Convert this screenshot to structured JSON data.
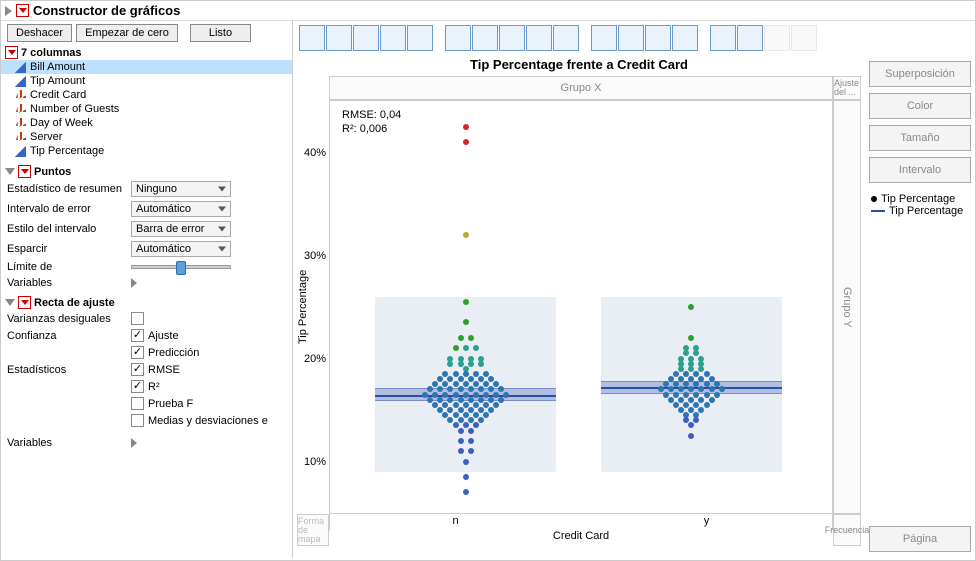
{
  "header": {
    "title": "Constructor de gráficos"
  },
  "buttons": {
    "undo": "Deshacer",
    "fresh": "Empezar de cero",
    "done": "Listo"
  },
  "columns_header": "7 columnas",
  "columns": [
    {
      "name": "Bill Amount",
      "type": "cont",
      "selected": true
    },
    {
      "name": "Tip Amount",
      "type": "cont"
    },
    {
      "name": "Credit Card",
      "type": "nom"
    },
    {
      "name": "Number of Guests",
      "type": "nom"
    },
    {
      "name": "Day of Week",
      "type": "nom"
    },
    {
      "name": "Server",
      "type": "nom"
    },
    {
      "name": "Tip Percentage",
      "type": "cont"
    }
  ],
  "section_points": "Puntos",
  "points": {
    "summary_label": "Estadístico de resumen",
    "summary_val": "Ninguno",
    "error_label": "Intervalo de error",
    "error_val": "Automático",
    "style_label": "Estilo del intervalo",
    "style_val": "Barra de error",
    "jitter_label": "Esparcir",
    "jitter_val": "Automático",
    "limit_label": "Límite de",
    "vars_label": "Variables"
  },
  "section_fit": "Recta de ajuste",
  "fit": {
    "uneq_label": "Varianzas desiguales",
    "conf_label": "Confianza",
    "ajuste": "Ajuste",
    "pred": "Predicción",
    "stats_label": "Estadísticos",
    "rmse": "RMSE",
    "r2": "R²",
    "ftest": "Prueba F",
    "means": "Medias y desviaciones e",
    "vars_label": "Variables"
  },
  "chart_title": "Tip Percentage frente a Credit Card",
  "dropzones": {
    "gx": "Grupo X",
    "ajuste": "Ajuste del ...",
    "gy": "Grupo Y",
    "forma": "Forma de mapa",
    "frec": "Frecuencia"
  },
  "side": {
    "superpos": "Superposición",
    "color": "Color",
    "tam": "Tamaño",
    "interval": "Intervalo",
    "pagina": "Página"
  },
  "legend": {
    "l1": "Tip Percentage",
    "l2": "Tip Percentage"
  },
  "chart_data": {
    "type": "scatter",
    "title": "Tip Percentage frente a Credit Card",
    "xlabel": "Credit Card",
    "ylabel": "Tip Percentage",
    "categories": [
      "n",
      "y"
    ],
    "ylim": [
      5,
      45
    ],
    "yticks": [
      10,
      20,
      30,
      40
    ],
    "ytick_labels": [
      "10%",
      "20%",
      "30%",
      "40%"
    ],
    "stats": {
      "rmse_label": "RMSE: 0,04",
      "r2_label": "R²: 0,006"
    },
    "fit": {
      "n": 16.5,
      "y": 17.2
    },
    "series": [
      {
        "name": "n",
        "points": [
          {
            "y": 42.5,
            "color": "#d62728"
          },
          {
            "y": 41.0,
            "color": "#d62728"
          },
          {
            "y": 32.0,
            "color": "#bfa82a"
          },
          {
            "y": 25.5,
            "color": "#2ca02c"
          },
          {
            "y": 23.5,
            "color": "#2ca02c"
          },
          {
            "y": 22.0,
            "color": "#2ca02c"
          },
          {
            "y": 22.0,
            "color": "#2ca02c"
          },
          {
            "y": 21.0,
            "color": "#2ca02c"
          },
          {
            "y": 21.0,
            "color": "#2d9f8f"
          },
          {
            "y": 21.0,
            "color": "#2d9f8f"
          },
          {
            "y": 20.0,
            "color": "#2d9f8f"
          },
          {
            "y": 20.0,
            "color": "#2d9f8f"
          },
          {
            "y": 20.0,
            "color": "#2d9f8f"
          },
          {
            "y": 20.0,
            "color": "#2d9f8f"
          },
          {
            "y": 19.5,
            "color": "#2d9f8f"
          },
          {
            "y": 19.5,
            "color": "#2d9f8f"
          },
          {
            "y": 19.5,
            "color": "#2d9f8f"
          },
          {
            "y": 19.5,
            "color": "#2d9f8f"
          },
          {
            "y": 19.0,
            "color": "#2d9f8f"
          },
          {
            "y": 18.5,
            "color": "#2d74b0"
          },
          {
            "y": 18.5,
            "color": "#2d74b0"
          },
          {
            "y": 18.5,
            "color": "#2d74b0"
          },
          {
            "y": 18.5,
            "color": "#2d74b0"
          },
          {
            "y": 18.5,
            "color": "#2d74b0"
          },
          {
            "y": 18.0,
            "color": "#2d74b0"
          },
          {
            "y": 18.0,
            "color": "#2d74b0"
          },
          {
            "y": 18.0,
            "color": "#2d74b0"
          },
          {
            "y": 18.0,
            "color": "#2d74b0"
          },
          {
            "y": 18.0,
            "color": "#2d74b0"
          },
          {
            "y": 18.0,
            "color": "#2d74b0"
          },
          {
            "y": 17.5,
            "color": "#2d74b0"
          },
          {
            "y": 17.5,
            "color": "#2d74b0"
          },
          {
            "y": 17.5,
            "color": "#2d74b0"
          },
          {
            "y": 17.5,
            "color": "#2d74b0"
          },
          {
            "y": 17.5,
            "color": "#2d74b0"
          },
          {
            "y": 17.5,
            "color": "#2d74b0"
          },
          {
            "y": 17.5,
            "color": "#2d74b0"
          },
          {
            "y": 17.0,
            "color": "#2d74b0"
          },
          {
            "y": 17.0,
            "color": "#2d74b0"
          },
          {
            "y": 17.0,
            "color": "#2d74b0"
          },
          {
            "y": 17.0,
            "color": "#2d74b0"
          },
          {
            "y": 17.0,
            "color": "#2d74b0"
          },
          {
            "y": 17.0,
            "color": "#2d74b0"
          },
          {
            "y": 17.0,
            "color": "#2d74b0"
          },
          {
            "y": 17.0,
            "color": "#2d74b0"
          },
          {
            "y": 16.5,
            "color": "#2d74b0"
          },
          {
            "y": 16.5,
            "color": "#2d74b0"
          },
          {
            "y": 16.5,
            "color": "#2d74b0"
          },
          {
            "y": 16.5,
            "color": "#2d74b0"
          },
          {
            "y": 16.5,
            "color": "#2d74b0"
          },
          {
            "y": 16.5,
            "color": "#2d74b0"
          },
          {
            "y": 16.5,
            "color": "#2d74b0"
          },
          {
            "y": 16.5,
            "color": "#2d74b0"
          },
          {
            "y": 16.5,
            "color": "#2d74b0"
          },
          {
            "y": 16.0,
            "color": "#2d74b0"
          },
          {
            "y": 16.0,
            "color": "#2d74b0"
          },
          {
            "y": 16.0,
            "color": "#2d74b0"
          },
          {
            "y": 16.0,
            "color": "#2d74b0"
          },
          {
            "y": 16.0,
            "color": "#2d74b0"
          },
          {
            "y": 16.0,
            "color": "#2d74b0"
          },
          {
            "y": 16.0,
            "color": "#2d74b0"
          },
          {
            "y": 16.0,
            "color": "#2d74b0"
          },
          {
            "y": 15.5,
            "color": "#2d74b0"
          },
          {
            "y": 15.5,
            "color": "#2d74b0"
          },
          {
            "y": 15.5,
            "color": "#2d74b0"
          },
          {
            "y": 15.5,
            "color": "#2d74b0"
          },
          {
            "y": 15.5,
            "color": "#2d74b0"
          },
          {
            "y": 15.5,
            "color": "#2d74b0"
          },
          {
            "y": 15.5,
            "color": "#2d74b0"
          },
          {
            "y": 15.0,
            "color": "#2d74b0"
          },
          {
            "y": 15.0,
            "color": "#2d74b0"
          },
          {
            "y": 15.0,
            "color": "#2d74b0"
          },
          {
            "y": 15.0,
            "color": "#2d74b0"
          },
          {
            "y": 15.0,
            "color": "#2d74b0"
          },
          {
            "y": 15.0,
            "color": "#2d74b0"
          },
          {
            "y": 14.5,
            "color": "#2d74b0"
          },
          {
            "y": 14.5,
            "color": "#2d74b0"
          },
          {
            "y": 14.5,
            "color": "#2d74b0"
          },
          {
            "y": 14.5,
            "color": "#2d74b0"
          },
          {
            "y": 14.5,
            "color": "#2d74b0"
          },
          {
            "y": 14.0,
            "color": "#2d74b0"
          },
          {
            "y": 14.0,
            "color": "#2d74b0"
          },
          {
            "y": 14.0,
            "color": "#2d74b0"
          },
          {
            "y": 14.0,
            "color": "#2d74b0"
          },
          {
            "y": 13.5,
            "color": "#3b5fc4"
          },
          {
            "y": 13.5,
            "color": "#3b5fc4"
          },
          {
            "y": 13.5,
            "color": "#3b5fc4"
          },
          {
            "y": 13.0,
            "color": "#3b5fc4"
          },
          {
            "y": 13.0,
            "color": "#3b5fc4"
          },
          {
            "y": 12.0,
            "color": "#3b5fc4"
          },
          {
            "y": 12.0,
            "color": "#3b5fc4"
          },
          {
            "y": 11.0,
            "color": "#3b5fc4"
          },
          {
            "y": 11.0,
            "color": "#3b5fc4"
          },
          {
            "y": 10.0,
            "color": "#3b5fc4"
          },
          {
            "y": 8.5,
            "color": "#3b5fc4"
          },
          {
            "y": 7.0,
            "color": "#3b5fc4"
          }
        ]
      },
      {
        "name": "y",
        "points": [
          {
            "y": 25.0,
            "color": "#2ca02c"
          },
          {
            "y": 22.0,
            "color": "#2ca02c"
          },
          {
            "y": 21.0,
            "color": "#2d9f8f"
          },
          {
            "y": 21.0,
            "color": "#2d9f8f"
          },
          {
            "y": 20.5,
            "color": "#2d9f8f"
          },
          {
            "y": 20.5,
            "color": "#2d9f8f"
          },
          {
            "y": 20.0,
            "color": "#2d9f8f"
          },
          {
            "y": 20.0,
            "color": "#2d9f8f"
          },
          {
            "y": 20.0,
            "color": "#2d9f8f"
          },
          {
            "y": 19.5,
            "color": "#2d9f8f"
          },
          {
            "y": 19.5,
            "color": "#2d9f8f"
          },
          {
            "y": 19.5,
            "color": "#2d9f8f"
          },
          {
            "y": 19.0,
            "color": "#2d9f8f"
          },
          {
            "y": 19.0,
            "color": "#2d9f8f"
          },
          {
            "y": 19.0,
            "color": "#2d9f8f"
          },
          {
            "y": 18.5,
            "color": "#2d74b0"
          },
          {
            "y": 18.5,
            "color": "#2d74b0"
          },
          {
            "y": 18.5,
            "color": "#2d74b0"
          },
          {
            "y": 18.5,
            "color": "#2d74b0"
          },
          {
            "y": 18.0,
            "color": "#2d74b0"
          },
          {
            "y": 18.0,
            "color": "#2d74b0"
          },
          {
            "y": 18.0,
            "color": "#2d74b0"
          },
          {
            "y": 18.0,
            "color": "#2d74b0"
          },
          {
            "y": 18.0,
            "color": "#2d74b0"
          },
          {
            "y": 17.5,
            "color": "#2d74b0"
          },
          {
            "y": 17.5,
            "color": "#2d74b0"
          },
          {
            "y": 17.5,
            "color": "#2d74b0"
          },
          {
            "y": 17.5,
            "color": "#2d74b0"
          },
          {
            "y": 17.5,
            "color": "#2d74b0"
          },
          {
            "y": 17.5,
            "color": "#2d74b0"
          },
          {
            "y": 17.0,
            "color": "#2d74b0"
          },
          {
            "y": 17.0,
            "color": "#2d74b0"
          },
          {
            "y": 17.0,
            "color": "#2d74b0"
          },
          {
            "y": 17.0,
            "color": "#2d74b0"
          },
          {
            "y": 17.0,
            "color": "#2d74b0"
          },
          {
            "y": 17.0,
            "color": "#2d74b0"
          },
          {
            "y": 17.0,
            "color": "#2d74b0"
          },
          {
            "y": 16.5,
            "color": "#2d74b0"
          },
          {
            "y": 16.5,
            "color": "#2d74b0"
          },
          {
            "y": 16.5,
            "color": "#2d74b0"
          },
          {
            "y": 16.5,
            "color": "#2d74b0"
          },
          {
            "y": 16.5,
            "color": "#2d74b0"
          },
          {
            "y": 16.5,
            "color": "#2d74b0"
          },
          {
            "y": 16.0,
            "color": "#2d74b0"
          },
          {
            "y": 16.0,
            "color": "#2d74b0"
          },
          {
            "y": 16.0,
            "color": "#2d74b0"
          },
          {
            "y": 16.0,
            "color": "#2d74b0"
          },
          {
            "y": 16.0,
            "color": "#2d74b0"
          },
          {
            "y": 15.5,
            "color": "#2d74b0"
          },
          {
            "y": 15.5,
            "color": "#2d74b0"
          },
          {
            "y": 15.5,
            "color": "#2d74b0"
          },
          {
            "y": 15.5,
            "color": "#2d74b0"
          },
          {
            "y": 15.0,
            "color": "#2d74b0"
          },
          {
            "y": 15.0,
            "color": "#2d74b0"
          },
          {
            "y": 15.0,
            "color": "#2d74b0"
          },
          {
            "y": 14.5,
            "color": "#2d74b0"
          },
          {
            "y": 14.5,
            "color": "#2d74b0"
          },
          {
            "y": 14.0,
            "color": "#3b5fc4"
          },
          {
            "y": 14.0,
            "color": "#3b5fc4"
          },
          {
            "y": 13.5,
            "color": "#3b5fc4"
          },
          {
            "y": 12.5,
            "color": "#3b5fc4"
          }
        ]
      }
    ]
  }
}
